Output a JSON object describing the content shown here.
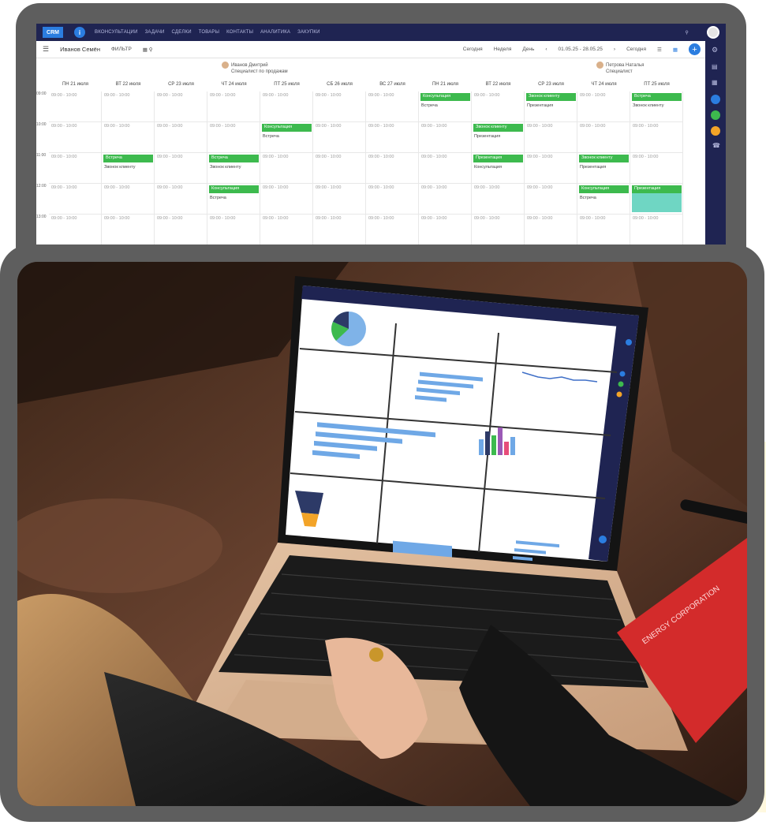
{
  "crm": {
    "logo_text": "CRM",
    "info_icon": "info-icon",
    "nav": [
      "ВКОНСУЛЬТАЦИИ",
      "ЗАДАЧИ",
      "СДЕЛКИ",
      "ТОВАРЫ",
      "КОНТАКТЫ",
      "АНАЛИТИКА",
      "ЗАКУПКИ"
    ],
    "toolbar": {
      "title": "Иванов Семён",
      "filter": "ФИЛЬТР",
      "view_today": "Сегодня",
      "view_week": "Неделя",
      "view_day": "День",
      "date_range": "01.05.25 - 28.05.25",
      "today_btn": "Сегодня"
    },
    "employees": [
      {
        "name": "Иванов Дмитрий",
        "role": "Специалист по продажам"
      },
      {
        "name": "Петрова Наталья",
        "role": "Специалист"
      }
    ],
    "days": [
      "ПН 21 июля",
      "ВТ 22 июля",
      "СР 23 июля",
      "ЧТ 24 июля",
      "ПТ 25 июля",
      "СБ 26 июля",
      "ВС 27 июля",
      "ПН 21 июля",
      "ВТ 22 июля",
      "СР 23 июля",
      "ЧТ 24 июля",
      "ПТ 25 июля"
    ],
    "slot_text": "09:00 - 10:00",
    "events": [
      "Консультация",
      "Встреча",
      "Звонок клиенту",
      "Презентация"
    ],
    "colors": {
      "top_bar": "#1f2452",
      "accent": "#2b7de0",
      "event": "#3dba4e",
      "teal": "#6fd6c3"
    }
  },
  "photo": {
    "notebook_label": "ENERGY CORPORATION"
  }
}
